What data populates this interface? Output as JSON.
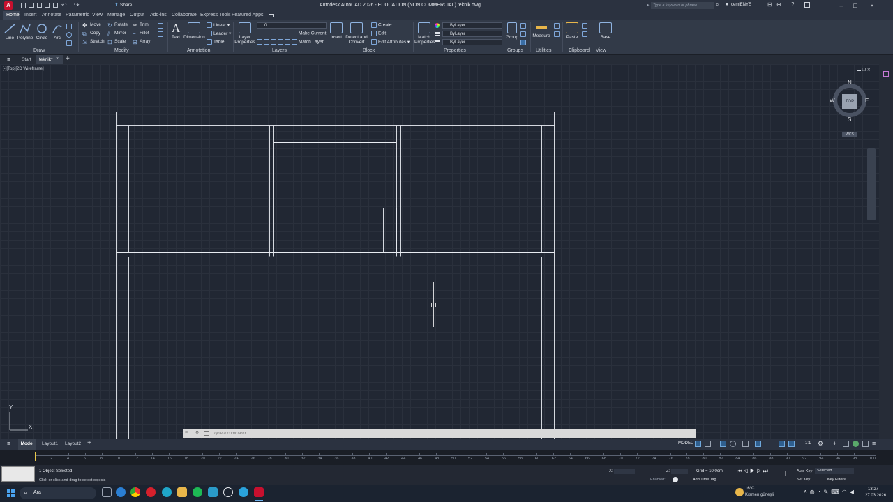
{
  "titlebar": {
    "app_badge": "A",
    "share_label": "Share",
    "title": "Autodesk AutoCAD 2026 - EDUCATION (NON COMMERCIAL)   teknik.dwg",
    "search_placeholder": "Type a keyword or phrase",
    "user": "cemlENYE"
  },
  "ribbon_tabs": [
    "Home",
    "Insert",
    "Annotate",
    "Parametric",
    "View",
    "Manage",
    "Output",
    "Add-ins",
    "Collaborate",
    "Express Tools",
    "Featured Apps"
  ],
  "ribbon": {
    "draw": {
      "line": "Line",
      "polyline": "Polyline",
      "circle": "Circle",
      "arc": "Arc",
      "label": "Draw"
    },
    "modify": {
      "move": "Move",
      "rotate": "Rotate",
      "trim": "Trim",
      "copy": "Copy",
      "mirror": "Mirror",
      "fillet": "Fillet",
      "stretch": "Stretch",
      "scale": "Scale",
      "array": "Array",
      "label": "Modify"
    },
    "annotation": {
      "text": "Text",
      "dimension": "Dimension",
      "linear": "Linear",
      "leader": "Leader",
      "table": "Table",
      "label": "Annotation"
    },
    "layers": {
      "layer_properties": "Layer Properties",
      "current_layer": "0",
      "make_current": "Make Current",
      "match_layer": "Match Layer",
      "label": "Layers"
    },
    "block": {
      "insert": "Insert",
      "detect": "Detect and Convert",
      "create": "Create",
      "edit": "Edit",
      "edit_attributes": "Edit Attributes",
      "label": "Block"
    },
    "properties": {
      "match": "Match Properties",
      "color": "ByLayer",
      "linetype": "ByLayer",
      "lineweight": "ByLayer",
      "label": "Properties"
    },
    "groups": {
      "group": "Group",
      "label": "Groups"
    },
    "utilities": {
      "measure": "Measure",
      "label": "Utilities"
    },
    "clipboard": {
      "paste": "Paste",
      "label": "Clipboard"
    },
    "view": {
      "base": "Base",
      "label": "View"
    }
  },
  "doc_tabs": {
    "start": "Start",
    "active": "teknik*"
  },
  "viewport": {
    "label": "[-][Top][2D Wireframe]",
    "viewcube": {
      "n": "N",
      "s": "S",
      "e": "E",
      "w": "W",
      "top": "TOP",
      "wcs": "WCS"
    },
    "ucs": {
      "x": "X",
      "y": "Y"
    }
  },
  "command_line": {
    "placeholder": "Type a command"
  },
  "layout_tabs": [
    "Model",
    "Layout1",
    "Layout2"
  ],
  "status": {
    "model": "MODEL",
    "scale": "1:1"
  },
  "timeline": {
    "ticks": [
      "2",
      "4",
      "6",
      "8",
      "10",
      "12",
      "14",
      "16",
      "18",
      "20",
      "22",
      "24",
      "26",
      "28",
      "30",
      "32",
      "34",
      "36",
      "38",
      "40",
      "42",
      "44",
      "46",
      "48",
      "50",
      "52",
      "54",
      "56",
      "58",
      "60",
      "62",
      "64",
      "66",
      "68",
      "70",
      "72",
      "74",
      "76",
      "78",
      "80",
      "82",
      "84",
      "86",
      "88",
      "90",
      "92",
      "94",
      "96",
      "98",
      "100"
    ]
  },
  "statusrow": {
    "selected": "1 Object Selected",
    "hint": "Click or click-and-drag to select objects",
    "x_label": "X:",
    "z_label": "Z:",
    "grid": "Grid = 10,0cm",
    "enabled": "Enabled:",
    "add_time_tag": "Add Time Tag",
    "auto_key": "Auto Key",
    "set_key": "Set Key",
    "selected_filter": "Selected",
    "key_filters": "Key Filters..."
  },
  "taskbar": {
    "search": "Ara",
    "weather_temp": "16°C",
    "weather_desc": "Kısmen güneşli",
    "time": "13:27",
    "date": "27.03.2026"
  }
}
